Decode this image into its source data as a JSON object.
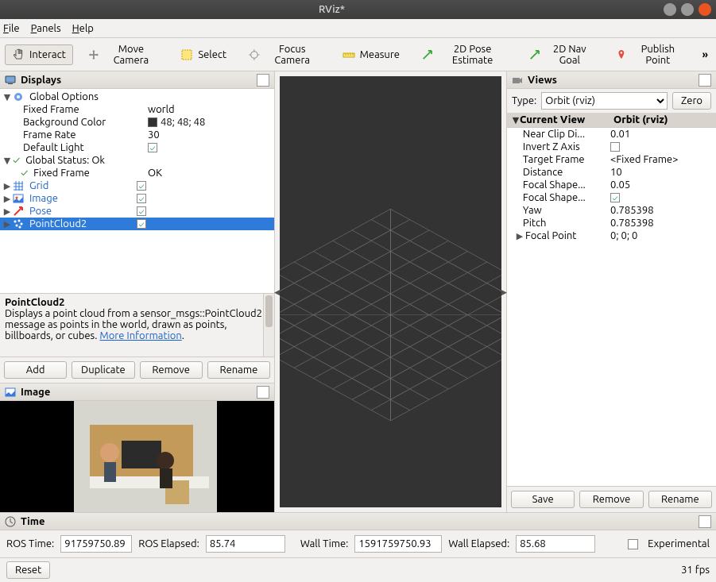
{
  "window": {
    "title": "RViz*"
  },
  "menus": {
    "file": "File",
    "panels": "Panels",
    "help": "Help"
  },
  "toolbar": {
    "interact": "Interact",
    "move_camera": "Move Camera",
    "select": "Select",
    "focus_camera": "Focus Camera",
    "measure": "Measure",
    "pose_estimate": "2D Pose Estimate",
    "nav_goal": "2D Nav Goal",
    "publish_point": "Publish Point",
    "overflow": "»"
  },
  "displays": {
    "title": "Displays",
    "global_options": "Global Options",
    "fixed_frame_label": "Fixed Frame",
    "fixed_frame_value": "world",
    "background_color_label": "Background Color",
    "background_color_value": "48; 48; 48",
    "background_color_hex": "#303030",
    "frame_rate_label": "Frame Rate",
    "frame_rate_value": "30",
    "default_light_label": "Default Light",
    "global_status_label": "Global Status: Ok",
    "status_fixed_frame_label": "Fixed Frame",
    "status_fixed_frame_value": "OK",
    "grid": "Grid",
    "image": "Image",
    "pose": "Pose",
    "pointcloud2": "PointCloud2",
    "desc_title": "PointCloud2",
    "desc_body": "Displays a point cloud from a sensor_msgs::PointCloud2 message as points in the world, drawn as points, billboards, or cubes. ",
    "desc_link": "More Information",
    "add": "Add",
    "duplicate": "Duplicate",
    "remove": "Remove",
    "rename": "Rename"
  },
  "image_panel": {
    "title": "Image"
  },
  "views": {
    "title": "Views",
    "type_label": "Type:",
    "type_value": "Orbit (rviz)",
    "zero": "Zero",
    "hdr_name": "Current View",
    "hdr_val": "Orbit (rviz)",
    "near_clip_label": "Near Clip Di...",
    "near_clip_value": "0.01",
    "invert_z_label": "Invert Z Axis",
    "target_frame_label": "Target Frame",
    "target_frame_value": "<Fixed Frame>",
    "distance_label": "Distance",
    "distance_value": "10",
    "focal_size_label": "Focal Shape...",
    "focal_size_value": "0.05",
    "focal_fixed_label": "Focal Shape...",
    "yaw_label": "Yaw",
    "yaw_value": "0.785398",
    "pitch_label": "Pitch",
    "pitch_value": "0.785398",
    "focal_point_label": "Focal Point",
    "focal_point_value": "0; 0; 0",
    "save": "Save",
    "remove": "Remove",
    "rename": "Rename"
  },
  "time": {
    "title": "Time",
    "ros_time_label": "ROS Time:",
    "ros_time_value": "91759750.89",
    "ros_elapsed_label": "ROS Elapsed:",
    "ros_elapsed_value": "85.74",
    "wall_time_label": "Wall Time:",
    "wall_time_value": "1591759750.93",
    "wall_elapsed_label": "Wall Elapsed:",
    "wall_elapsed_value": "85.68",
    "experimental": "Experimental"
  },
  "footer": {
    "reset": "Reset",
    "fps": "31 fps"
  }
}
